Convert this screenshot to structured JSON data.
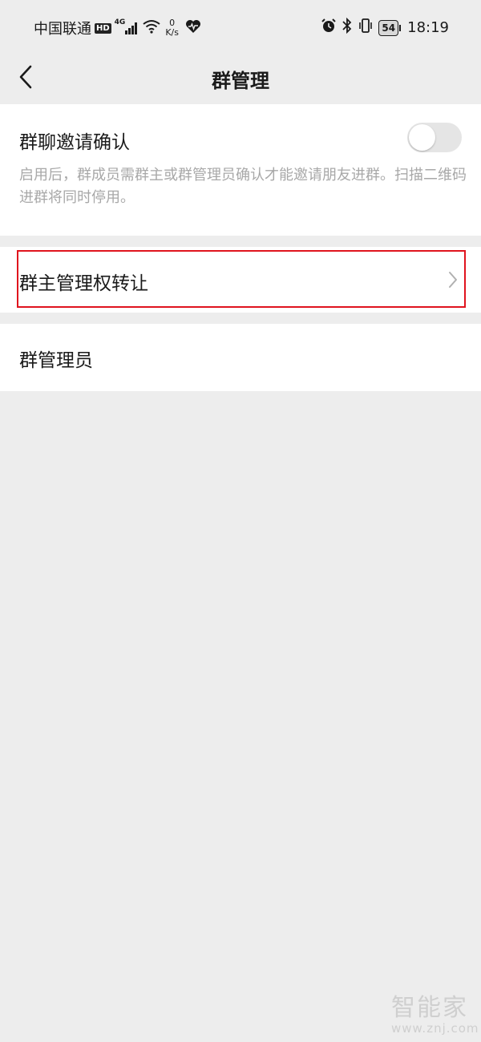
{
  "status_bar": {
    "carrier": "中国联通",
    "hd_badge": "HD",
    "network_type": "4G",
    "speed_value": "0",
    "speed_unit": "K/s",
    "battery_level": "54",
    "time": "18:19",
    "icons": [
      "signal-icon",
      "wifi-icon",
      "health-heart-icon",
      "alarm-icon",
      "bluetooth-icon",
      "vibrate-icon",
      "battery-icon"
    ]
  },
  "nav": {
    "title": "群管理",
    "back_icon": "chevron-left-icon"
  },
  "invite_confirm": {
    "label": "群聊邀请确认",
    "enabled": false,
    "description": "启用后，群成员需群主或群管理员确认才能邀请朋友进群。扫描二维码进群将同时停用。"
  },
  "owner_transfer": {
    "label": "群主管理权转让",
    "highlighted": true,
    "highlight_color": "#e0141e",
    "chevron_icon": "chevron-right-icon"
  },
  "admins": {
    "label": "群管理员"
  },
  "watermark": {
    "logo": "智能家",
    "url": "www.znj.com"
  },
  "colors": {
    "background": "#ededed",
    "card": "#ffffff",
    "secondary_text": "#a8a8a8",
    "toggle_off": "#e5e5e5"
  }
}
